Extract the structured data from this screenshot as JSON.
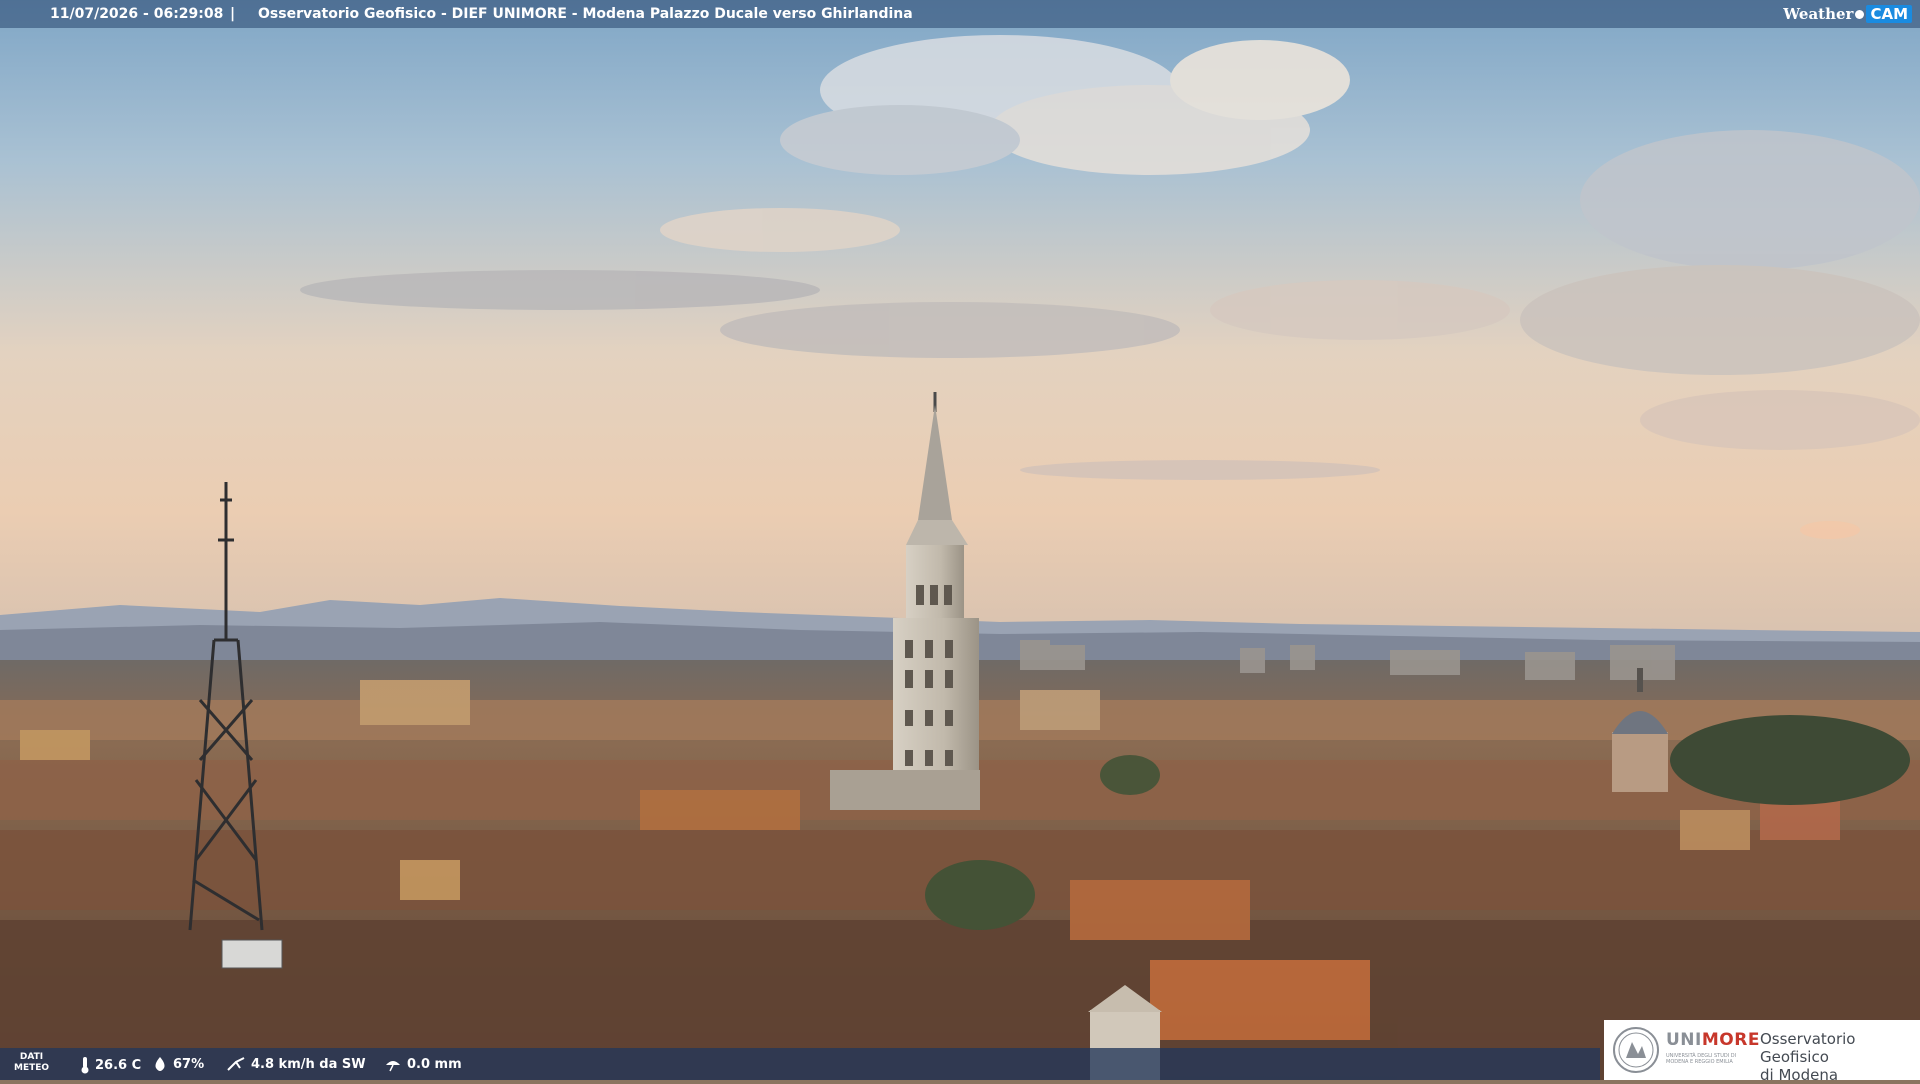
{
  "header": {
    "timestamp": "11/07/2026 - 06:29:08",
    "separator": "|",
    "title": "Osservatorio Geofisico - DIEF UNIMORE - Modena Palazzo Ducale verso Ghirlandina",
    "brand_weather": "Weather",
    "brand_cam": "CAM"
  },
  "weather": {
    "label_line1": "DATI",
    "label_line2": "METEO",
    "temperature": "26.6 C",
    "humidity": "67%",
    "wind": "4.8 km/h da SW",
    "rain": "0.0 mm"
  },
  "logo": {
    "uni": "UNI",
    "more": "MORE",
    "subtitle": "UNIVERSITÀ DEGLI STUDI DI MODENA E REGGIO EMILIA",
    "line1": "Osservatorio Geofisico",
    "line2": "di Modena"
  },
  "colors": {
    "sky_top": "#8fb0cc",
    "sky_horizon": "#e9cfb4",
    "roofs": "#8a5a3e",
    "tower": "#c9c2b5",
    "unimore_red": "#c7372b",
    "bar": "#28466e"
  }
}
